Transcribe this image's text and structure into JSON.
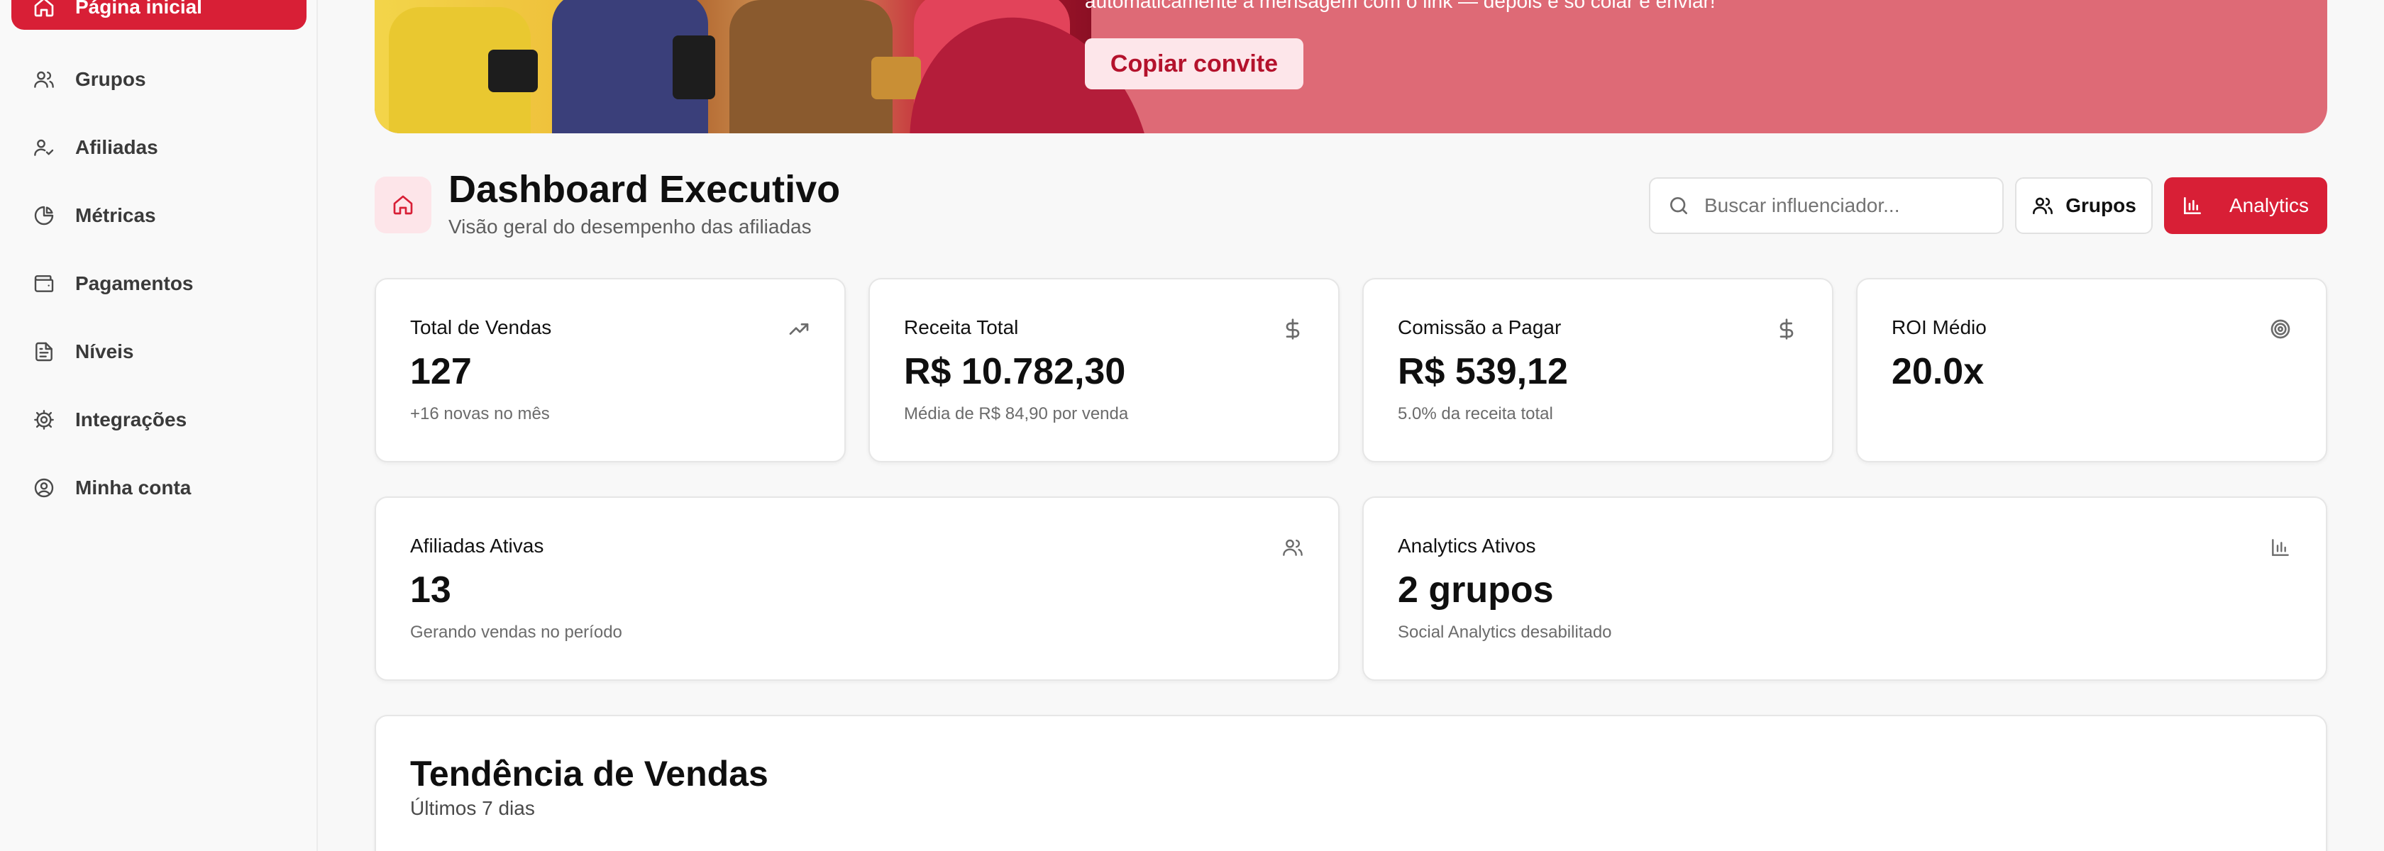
{
  "sidebar": {
    "active_item": {
      "label": "Página inicial",
      "icon": "home-icon"
    },
    "items": [
      {
        "label": "Grupos",
        "icon": "users-icon"
      },
      {
        "label": "Afiliadas",
        "icon": "user-check-icon"
      },
      {
        "label": "Métricas",
        "icon": "pie-chart-icon"
      },
      {
        "label": "Pagamentos",
        "icon": "wallet-icon"
      },
      {
        "label": "Níveis",
        "icon": "file-text-icon"
      },
      {
        "label": "Integrações",
        "icon": "gear-icon"
      },
      {
        "label": "Minha conta",
        "icon": "user-circle-icon"
      }
    ]
  },
  "banner": {
    "text": "automaticamente a mensagem com o link — depois é só colar e enviar!",
    "button_label": "Copiar convite"
  },
  "header": {
    "title": "Dashboard Executivo",
    "subtitle": "Visão geral do desempenho das afiliadas",
    "search_placeholder": "Buscar influenciador...",
    "grupos_label": "Grupos",
    "analytics_label": "Analytics"
  },
  "stats": [
    {
      "label": "Total de Vendas",
      "value": "127",
      "sub": "+16 novas no mês",
      "icon": "trending-up-icon"
    },
    {
      "label": "Receita Total",
      "value": "R$ 10.782,30",
      "sub": "Média de R$ 84,90 por venda",
      "icon": "dollar-icon"
    },
    {
      "label": "Comissão a Pagar",
      "value": "R$ 539,12",
      "sub": "5.0% da receita total",
      "icon": "dollar-icon"
    },
    {
      "label": "ROI Médio",
      "value": "20.0x",
      "sub": "",
      "icon": "target-icon"
    },
    {
      "label": "Afiliadas Ativas",
      "value": "13",
      "sub": "Gerando vendas no período",
      "icon": "users-icon"
    },
    {
      "label": "Analytics Ativos",
      "value": "2 grupos",
      "sub": "Social Analytics desabilitado",
      "icon": "bar-chart-icon"
    }
  ],
  "trend": {
    "title": "Tendência de Vendas",
    "subtitle": "Últimos 7 dias"
  },
  "colors": {
    "accent": "#d81f36",
    "accent_soft": "#fde5e9",
    "banner": "#de6a76"
  }
}
